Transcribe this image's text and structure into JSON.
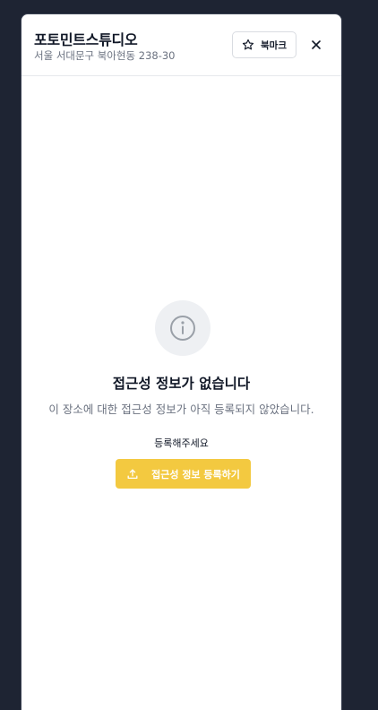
{
  "header": {
    "title": "포토민트스튜디오",
    "address": "서울 서대문구 북아현동 238-30",
    "bookmark_label": "북마크",
    "bookmark_icon": "star-icon",
    "close_icon": "close-icon"
  },
  "empty_state": {
    "icon": "info-icon",
    "title": "접근성 정보가 없습니다",
    "description": "이 장소에 대한 접근성 정보가 아직 등록되지 않았습니다.",
    "hint": "등록해주세요",
    "button_label": "접근성 정보 등록하기",
    "button_icon": "upload-icon"
  },
  "colors": {
    "backdrop": "#1e2433",
    "accent": "#f3c940",
    "text_primary": "#111827",
    "text_secondary": "#6b7280"
  }
}
